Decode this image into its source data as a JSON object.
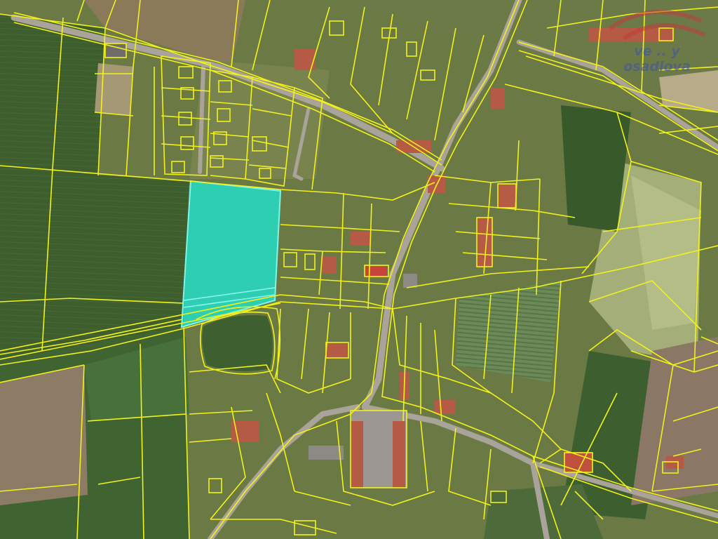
{
  "map": {
    "type": "cadastral-parcel-map-over-aerial-orthophoto",
    "colors": {
      "parcel_boundary": "#f2f21a",
      "selected_parcel_fill": "#1ee6d2",
      "selected_parcel_stroke": "#7ff5ea",
      "field_dark": "#3d5a2c",
      "field_light": "#6f8a48",
      "field_bare": "#8c7c66",
      "village_base": "#6f7d4a",
      "roads": "#a9a39a",
      "roofs_red": "#b55a44",
      "roofs_grey": "#8d8a86",
      "watermark_red": "#c23a3a",
      "watermark_text": "#3c50aa"
    },
    "selected_parcel": {
      "highlighted": true
    },
    "watermark": {
      "line1": "ve .. y",
      "line2": "osadlova"
    }
  }
}
